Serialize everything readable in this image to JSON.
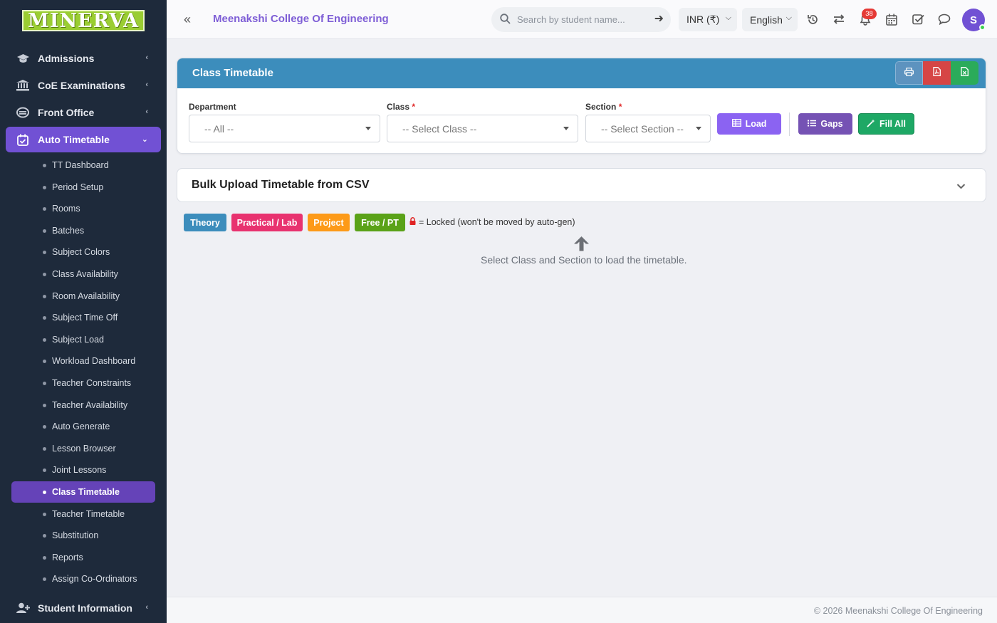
{
  "brand": {
    "logo_text": "MINERVA"
  },
  "sidebar": {
    "modules": [
      {
        "label": "Admissions",
        "icon": "graduation-cap-icon"
      },
      {
        "label": "CoE Examinations",
        "icon": "institution-icon"
      },
      {
        "label": "Front Office",
        "icon": "front-office-icon"
      },
      {
        "label": "Auto Timetable",
        "icon": "calendar-check-icon",
        "expanded": true
      },
      {
        "label": "Student Information",
        "icon": "user-plus-icon"
      }
    ],
    "sub_items": [
      "TT Dashboard",
      "Period Setup",
      "Rooms",
      "Batches",
      "Subject Colors",
      "Class Availability",
      "Room Availability",
      "Subject Time Off",
      "Subject Load",
      "Workload Dashboard",
      "Teacher Constraints",
      "Teacher Availability",
      "Auto Generate",
      "Lesson Browser",
      "Joint Lessons",
      "Class Timetable",
      "Teacher Timetable",
      "Substitution",
      "Reports",
      "Assign Co-Ordinators"
    ],
    "active_sub_item": "Class Timetable"
  },
  "header": {
    "college_name": "Meenakshi College Of Engineering",
    "search_placeholder": "Search by student name...",
    "currency": "INR (₹)",
    "language": "English",
    "notification_count": "38",
    "avatar_initial": "S"
  },
  "timetable_card": {
    "title": "Class Timetable",
    "department": {
      "label": "Department",
      "value": "-- All --"
    },
    "class": {
      "label": "Class",
      "required_mark": "*",
      "value": "-- Select Class --"
    },
    "section": {
      "label": "Section",
      "required_mark": "*",
      "value": "-- Select Section --"
    },
    "load_button": "Load",
    "gaps_button": "Gaps",
    "fill_all_button": "Fill All"
  },
  "bulk_upload": {
    "title": "Bulk Upload Timetable from CSV"
  },
  "legend": {
    "items": [
      {
        "label": "Theory",
        "color": "#3c8dbc"
      },
      {
        "label": "Practical / Lab",
        "color": "#e8326f"
      },
      {
        "label": "Project",
        "color": "#fd9a18"
      },
      {
        "label": "Free / PT",
        "color": "#5aa218"
      }
    ],
    "lock_note": "= Locked (won't be moved by auto-gen)"
  },
  "hint_text": "Select Class and Section to load the timetable.",
  "footer": {
    "copyright": "© 2026 Meenakshi College Of Engineering"
  },
  "colors": {
    "accent": "#7151d4",
    "sidebar_bg": "#1e2a3b",
    "card_header": "#3c8dbc"
  }
}
